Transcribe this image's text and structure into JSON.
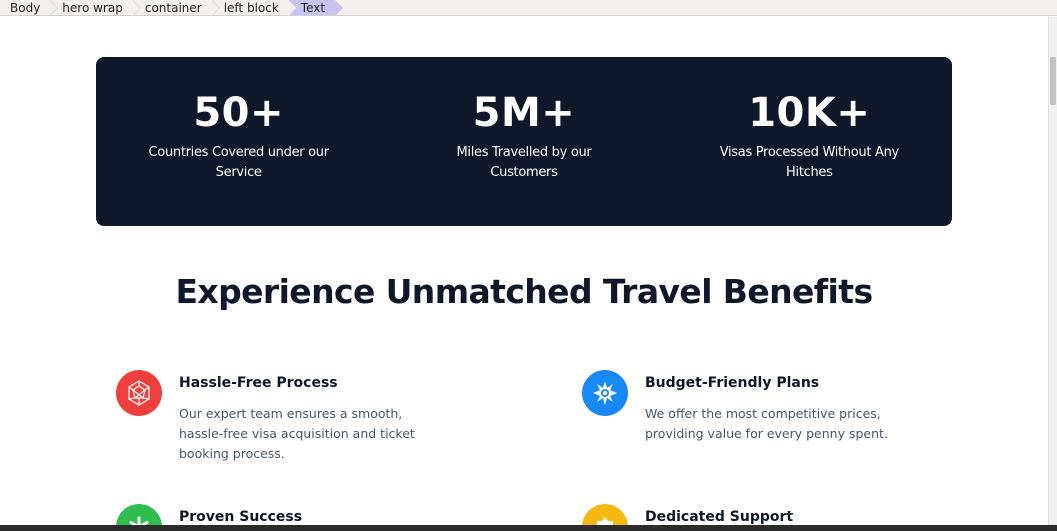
{
  "breadcrumb": [
    "Body",
    "hero wrap",
    "container",
    "left block",
    "Text"
  ],
  "stats": [
    {
      "value": "50+",
      "label": "Countries Covered under our Service"
    },
    {
      "value": "5M+",
      "label": "Miles Travelled by our Customers"
    },
    {
      "value": "10K+",
      "label": "Visas Processed Without Any Hitches"
    }
  ],
  "heading": "Experience Unmatched Travel Benefits",
  "features": [
    {
      "title": "Hassle-Free Process",
      "desc": "Our expert team ensures a smooth, hassle-free visa acquisition and ticket booking process.",
      "icon": "geometric-sphere-icon",
      "color": "#ef3e3e"
    },
    {
      "title": "Budget-Friendly Plans",
      "desc": "We offer the most competitive prices, providing value for every penny spent.",
      "icon": "sunburst-icon",
      "color": "#1788f5"
    },
    {
      "title": "Proven Success",
      "desc": "",
      "icon": "asterisk-icon",
      "color": "#2ebd4e"
    },
    {
      "title": "Dedicated Support",
      "desc": "",
      "icon": "badge-icon",
      "color": "#f5b80e"
    }
  ]
}
